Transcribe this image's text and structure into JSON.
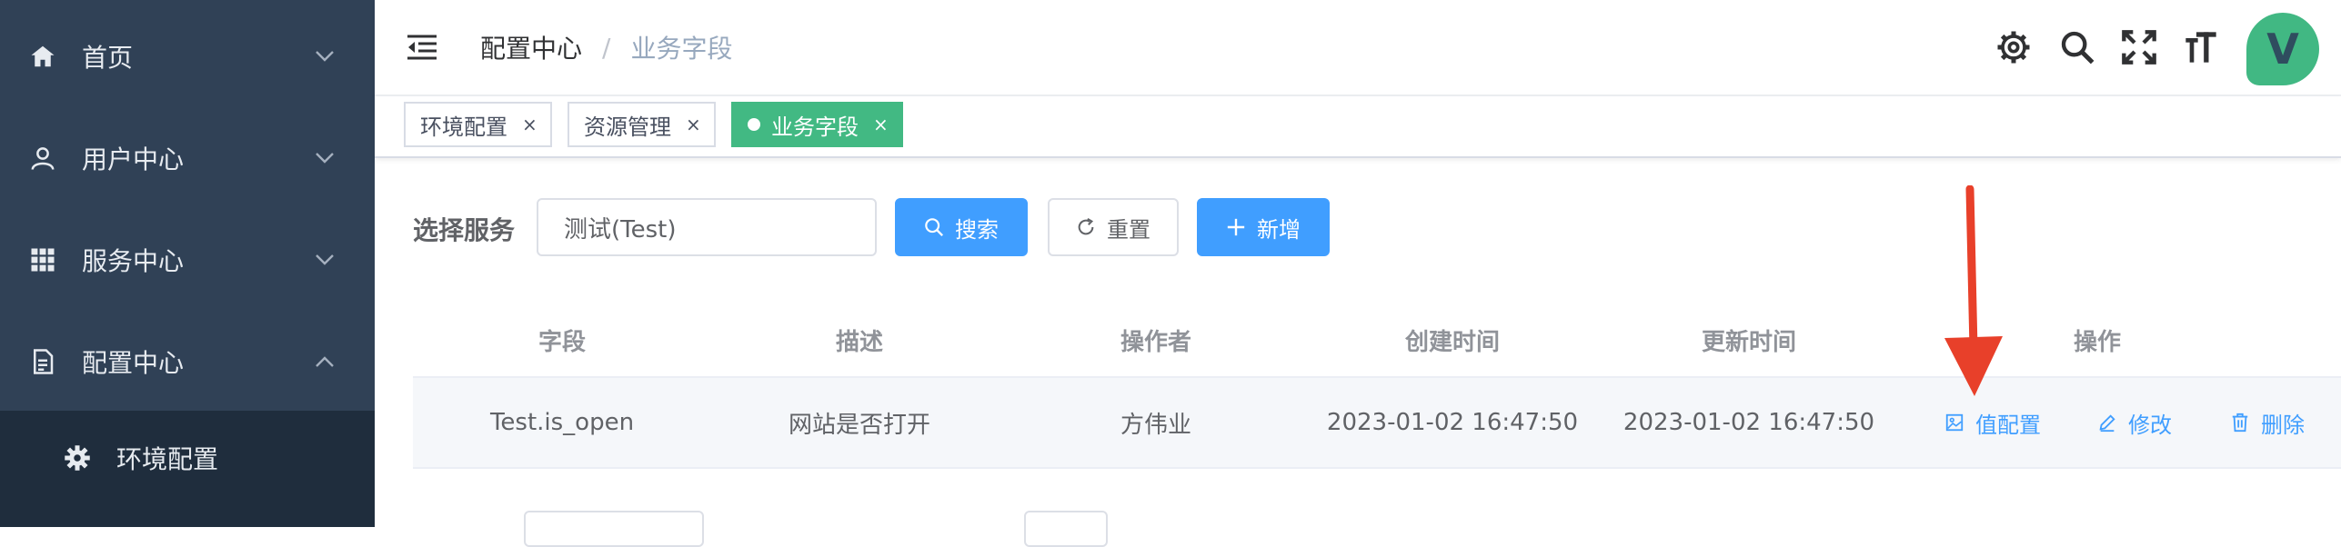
{
  "sidebar": {
    "items": [
      {
        "label": "首页",
        "icon": "home-icon"
      },
      {
        "label": "用户中心",
        "icon": "user-icon"
      },
      {
        "label": "服务中心",
        "icon": "grid-icon"
      },
      {
        "label": "配置中心",
        "icon": "document-icon"
      }
    ],
    "sub_items": [
      {
        "label": "环境配置",
        "icon": "gear-icon"
      }
    ]
  },
  "header": {
    "breadcrumb": [
      "配置中心",
      "业务字段"
    ],
    "avatar_letter": "V"
  },
  "tags": [
    {
      "label": "环境配置",
      "active": false
    },
    {
      "label": "资源管理",
      "active": false
    },
    {
      "label": "业务字段",
      "active": true
    }
  ],
  "search": {
    "label": "选择服务",
    "value": "测试(Test)",
    "search_button": "搜索",
    "reset_button": "重置",
    "add_button": "新增"
  },
  "table": {
    "columns": [
      "字段",
      "描述",
      "操作者",
      "创建时间",
      "更新时间",
      "操作"
    ],
    "rows": [
      {
        "field": "Test.is_open",
        "description": "网站是否打开",
        "operator": "方伟业",
        "created": "2023-01-02 16:47:50",
        "updated": "2023-01-02 16:47:50",
        "actions": [
          "值配置",
          "修改",
          "删除"
        ]
      }
    ]
  },
  "colors": {
    "sidebar_bg": "#304156",
    "submenu_bg": "#1f2d3d",
    "primary": "#409eff",
    "tag_active": "#42b983",
    "annotation": "#e8402a"
  }
}
